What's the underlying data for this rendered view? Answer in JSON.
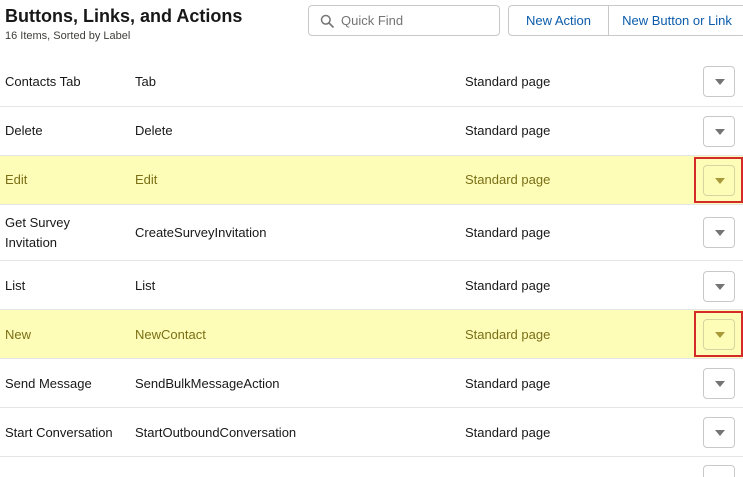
{
  "header": {
    "title": "Buttons, Links, and Actions",
    "subtitle": "16 Items, Sorted by Label"
  },
  "search": {
    "placeholder": "Quick Find",
    "icon": "search-icon"
  },
  "actions": {
    "new_action": "New Action",
    "new_button_or_link": "New Button or Link"
  },
  "colors": {
    "link": "#0b5cab",
    "highlight_row": "#fdfdb8",
    "annotation_box": "#d42a2a"
  },
  "rows": [
    {
      "label": "Contacts Tab",
      "name": "Tab",
      "overridden_with": "Standard page",
      "highlighted": false
    },
    {
      "label": "Delete",
      "name": "Delete",
      "overridden_with": "Standard page",
      "highlighted": false
    },
    {
      "label": "Edit",
      "name": "Edit",
      "overridden_with": "Standard page",
      "highlighted": true
    },
    {
      "label": "Get Survey Invitation",
      "name": "CreateSurveyInvitation",
      "overridden_with": "Standard page",
      "highlighted": false
    },
    {
      "label": "List",
      "name": "List",
      "overridden_with": "Standard page",
      "highlighted": false
    },
    {
      "label": "New",
      "name": "NewContact",
      "overridden_with": "Standard page",
      "highlighted": true
    },
    {
      "label": "Send Message",
      "name": "SendBulkMessageAction",
      "overridden_with": "Standard page",
      "highlighted": false
    },
    {
      "label": "Start Conversation",
      "name": "StartOutboundConversation",
      "overridden_with": "Standard page",
      "highlighted": false
    },
    {
      "label": "",
      "name": "",
      "overridden_with": "",
      "highlighted": false
    }
  ]
}
